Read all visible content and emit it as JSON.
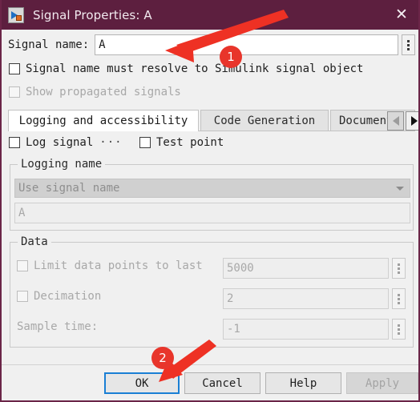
{
  "window": {
    "title": "Signal Properties: A",
    "icon": "simulink-signal-icon",
    "close_label": "✕",
    "titlebar_color": "#5d1f3f",
    "border_color": "#6b2548"
  },
  "form": {
    "signal_name_label": "Signal name:",
    "signal_name_value": "A",
    "signal_name_more_button": "⋮",
    "resolve_checkbox_label": "Signal name must resolve to Simulink signal object",
    "resolve_checkbox_checked": false,
    "propagated_checkbox_label": "Show propagated signals",
    "propagated_checkbox_checked": false,
    "propagated_checkbox_enabled": false
  },
  "tabs": {
    "items": [
      {
        "label": "Logging and accessibility",
        "active": true
      },
      {
        "label": "Code Generation",
        "active": false
      },
      {
        "label": "Document",
        "active": false
      }
    ],
    "scroll_left_enabled": false,
    "scroll_right_enabled": true
  },
  "logging_tab": {
    "log_signal_label": "Log signal",
    "log_signal_checked": false,
    "log_signal_ellipsis": "···",
    "test_point_label": "Test point",
    "test_point_checked": false,
    "logging_name_group": "Logging name",
    "logging_name_mode": "Use signal name",
    "logging_name_value": "A",
    "data_group": "Data",
    "limit_points_label": "Limit data points to last",
    "limit_points_checked": false,
    "limit_points_value": "5000",
    "decimation_label": "Decimation",
    "decimation_checked": false,
    "decimation_value": "2",
    "sample_time_label": "Sample time:",
    "sample_time_value": "-1"
  },
  "buttons": {
    "ok": "OK",
    "cancel": "Cancel",
    "help": "Help",
    "apply": "Apply",
    "apply_enabled": false,
    "ok_focused": true
  },
  "annotations": {
    "accent_color": "#e8352b",
    "markers": [
      {
        "number": "1",
        "target": "signal-name-input"
      },
      {
        "number": "2",
        "target": "ok-button"
      }
    ]
  }
}
